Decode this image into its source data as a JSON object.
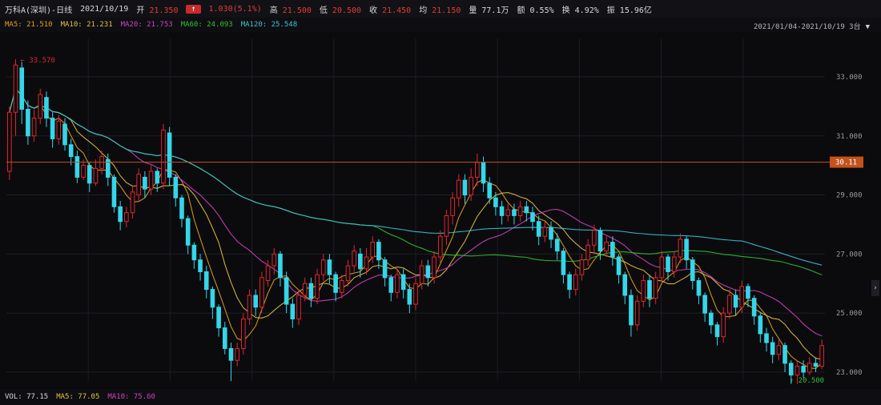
{
  "infobar": {
    "name": "万科A(深圳)-日线",
    "date": "2021/10/19",
    "open_label": "开",
    "open_value": "21.350",
    "pill": "↑",
    "change": "1.030(5.1%)",
    "high_label": "高",
    "high_value": "21.500",
    "low_label": "低",
    "low_value": "20.500",
    "close_label": "收",
    "close_value": "21.450",
    "avg_label": "均",
    "avg_value": "21.150",
    "volume_label": "量",
    "volume_value": "77.1万",
    "amount_label": "额",
    "amount_value": "0.55%",
    "turnover_label": "换",
    "turnover_value": "4.92%",
    "amplitude_label": "振",
    "amplitude_value": "15.96亿"
  },
  "ma_bar": [
    {
      "label": "MA5: 21.510",
      "color": "#e0a020"
    },
    {
      "label": "MA10: 21.231",
      "color": "#e0c040"
    },
    {
      "label": "MA20: 21.753",
      "color": "#d040c0"
    },
    {
      "label": "MA60: 24.093",
      "color": "#30c030"
    },
    {
      "label": "MA120: 25.548",
      "color": "#40c0d0"
    }
  ],
  "range": {
    "text": "2021/01/04-2021/10/19 3台",
    "arrow": "▼"
  },
  "price_tag": "30.11",
  "high_marker": "33.570",
  "low_marker": "20.500",
  "bottom_bar": [
    {
      "label": "VOL: 77.15",
      "color": "#d8d8d8"
    },
    {
      "label": "MA5: 77.05",
      "color": "#e0c040"
    },
    {
      "label": "MA10: 75.60",
      "color": "#d040c0"
    }
  ],
  "chart_data": {
    "type": "candlestick",
    "ylim": [
      22.7,
      34.3
    ],
    "y_ticks": [
      "33.000",
      "31.000",
      "29.000",
      "27.000",
      "25.000",
      "23.000"
    ],
    "reference_level": 30.11,
    "candles": [
      [
        29.8,
        31.8,
        29.5,
        32.0
      ],
      [
        31.8,
        33.4,
        31.0,
        33.6
      ],
      [
        33.3,
        31.9,
        31.4,
        33.5
      ],
      [
        31.9,
        31.0,
        30.7,
        32.2
      ],
      [
        31.0,
        31.6,
        30.8,
        31.9
      ],
      [
        31.6,
        32.4,
        31.4,
        32.6
      ],
      [
        32.3,
        31.6,
        31.3,
        32.5
      ],
      [
        31.6,
        30.9,
        30.6,
        31.8
      ],
      [
        30.9,
        31.5,
        30.7,
        31.7
      ],
      [
        31.4,
        30.7,
        30.5,
        31.6
      ],
      [
        30.7,
        30.3,
        30.0,
        30.9
      ],
      [
        30.3,
        29.6,
        29.4,
        30.5
      ],
      [
        29.6,
        30.0,
        29.5,
        30.2
      ],
      [
        30.0,
        29.4,
        29.1,
        30.1
      ],
      [
        29.4,
        29.9,
        29.3,
        30.2
      ],
      [
        29.9,
        30.3,
        29.7,
        30.5
      ],
      [
        30.2,
        29.6,
        29.3,
        30.4
      ],
      [
        29.6,
        28.6,
        28.4,
        29.7
      ],
      [
        28.6,
        28.1,
        27.8,
        28.8
      ],
      [
        28.1,
        28.4,
        27.9,
        28.6
      ],
      [
        28.4,
        29.1,
        28.2,
        29.3
      ],
      [
        29.0,
        29.7,
        28.8,
        29.9
      ],
      [
        29.6,
        29.2,
        28.9,
        29.8
      ],
      [
        29.2,
        29.8,
        29.0,
        30.0
      ],
      [
        29.8,
        29.4,
        29.1,
        29.9
      ],
      [
        29.4,
        31.2,
        29.2,
        31.4
      ],
      [
        31.1,
        29.6,
        29.3,
        31.3
      ],
      [
        29.6,
        28.9,
        28.6,
        29.7
      ],
      [
        28.9,
        28.2,
        27.9,
        29.0
      ],
      [
        28.2,
        27.3,
        27.0,
        28.3
      ],
      [
        27.3,
        26.8,
        26.5,
        27.4
      ],
      [
        26.8,
        26.4,
        26.1,
        27.0
      ],
      [
        26.4,
        25.8,
        25.5,
        26.6
      ],
      [
        25.8,
        25.2,
        24.8,
        25.9
      ],
      [
        25.2,
        24.5,
        24.2,
        25.3
      ],
      [
        24.5,
        23.8,
        23.6,
        24.7
      ],
      [
        23.8,
        23.4,
        22.7,
        24.0
      ],
      [
        23.4,
        23.8,
        23.2,
        24.0
      ],
      [
        23.8,
        24.8,
        23.6,
        25.0
      ],
      [
        24.8,
        25.6,
        24.6,
        25.8
      ],
      [
        25.6,
        25.2,
        24.9,
        25.8
      ],
      [
        25.2,
        26.2,
        25.0,
        26.4
      ],
      [
        26.1,
        26.6,
        25.9,
        26.8
      ],
      [
        26.6,
        27.0,
        26.3,
        27.2
      ],
      [
        27.0,
        26.2,
        25.9,
        27.1
      ],
      [
        26.2,
        25.3,
        25.0,
        26.4
      ],
      [
        25.3,
        24.8,
        24.5,
        25.5
      ],
      [
        24.8,
        25.6,
        24.6,
        25.8
      ],
      [
        25.6,
        26.0,
        25.4,
        26.2
      ],
      [
        26.0,
        25.5,
        25.2,
        26.2
      ],
      [
        25.5,
        26.3,
        25.3,
        26.5
      ],
      [
        26.3,
        26.8,
        26.1,
        27.0
      ],
      [
        26.8,
        26.3,
        26.0,
        27.0
      ],
      [
        26.3,
        25.7,
        25.4,
        26.4
      ],
      [
        25.7,
        26.1,
        25.5,
        26.3
      ],
      [
        26.1,
        26.6,
        25.9,
        26.8
      ],
      [
        26.6,
        27.1,
        26.4,
        27.3
      ],
      [
        27.0,
        26.5,
        26.2,
        27.2
      ],
      [
        26.5,
        26.9,
        26.3,
        27.2
      ],
      [
        26.9,
        27.4,
        26.7,
        27.6
      ],
      [
        27.4,
        26.8,
        26.5,
        27.5
      ],
      [
        26.8,
        26.2,
        25.9,
        26.9
      ],
      [
        26.2,
        25.7,
        25.4,
        26.3
      ],
      [
        25.7,
        26.3,
        25.5,
        26.5
      ],
      [
        26.3,
        25.8,
        25.5,
        26.5
      ],
      [
        25.8,
        25.3,
        25.0,
        26.0
      ],
      [
        25.3,
        26.0,
        25.1,
        26.2
      ],
      [
        26.0,
        26.6,
        25.8,
        26.8
      ],
      [
        26.6,
        26.2,
        25.9,
        26.8
      ],
      [
        26.2,
        26.9,
        26.0,
        27.1
      ],
      [
        26.9,
        27.6,
        26.7,
        27.8
      ],
      [
        27.6,
        28.3,
        27.3,
        28.5
      ],
      [
        28.3,
        28.9,
        28.0,
        29.1
      ],
      [
        28.9,
        29.5,
        28.6,
        29.7
      ],
      [
        29.5,
        29.0,
        28.7,
        29.7
      ],
      [
        29.0,
        29.6,
        28.8,
        29.9
      ],
      [
        29.6,
        30.1,
        29.3,
        30.4
      ],
      [
        30.1,
        29.4,
        29.1,
        30.3
      ],
      [
        29.4,
        28.9,
        28.7,
        29.6
      ],
      [
        28.9,
        28.6,
        28.3,
        29.1
      ],
      [
        28.6,
        28.3,
        28.0,
        28.8
      ],
      [
        28.3,
        28.5,
        28.1,
        28.7
      ],
      [
        28.5,
        28.3,
        28.0,
        28.7
      ],
      [
        28.3,
        28.6,
        28.1,
        28.8
      ],
      [
        28.6,
        28.4,
        28.1,
        28.8
      ],
      [
        28.4,
        28.1,
        27.8,
        28.6
      ],
      [
        28.1,
        27.6,
        27.3,
        28.3
      ],
      [
        27.6,
        27.9,
        27.4,
        28.1
      ],
      [
        27.9,
        27.5,
        27.2,
        28.1
      ],
      [
        27.5,
        27.1,
        26.8,
        27.7
      ],
      [
        27.1,
        26.3,
        26.0,
        27.2
      ],
      [
        26.3,
        25.8,
        25.5,
        26.4
      ],
      [
        25.8,
        26.3,
        25.6,
        26.5
      ],
      [
        26.3,
        26.8,
        26.1,
        27.0
      ],
      [
        26.8,
        27.3,
        26.6,
        27.5
      ],
      [
        27.3,
        27.8,
        27.0,
        28.0
      ],
      [
        27.8,
        27.1,
        26.8,
        27.9
      ],
      [
        27.1,
        27.4,
        26.9,
        27.6
      ],
      [
        27.4,
        26.9,
        26.6,
        27.6
      ],
      [
        26.9,
        26.3,
        26.0,
        27.0
      ],
      [
        26.3,
        25.6,
        25.3,
        26.4
      ],
      [
        25.6,
        24.6,
        24.2,
        25.8
      ],
      [
        24.6,
        25.4,
        24.4,
        25.6
      ],
      [
        25.4,
        26.1,
        25.2,
        26.3
      ],
      [
        26.1,
        25.5,
        25.2,
        26.3
      ],
      [
        25.5,
        26.2,
        25.3,
        26.4
      ],
      [
        26.2,
        26.9,
        26.0,
        27.1
      ],
      [
        26.9,
        26.4,
        26.1,
        27.0
      ],
      [
        26.4,
        26.9,
        26.2,
        27.1
      ],
      [
        26.9,
        27.5,
        26.7,
        27.7
      ],
      [
        27.5,
        26.8,
        26.5,
        27.6
      ],
      [
        26.8,
        26.1,
        25.8,
        26.9
      ],
      [
        26.1,
        25.6,
        25.3,
        26.2
      ],
      [
        25.6,
        25.0,
        24.7,
        25.7
      ],
      [
        25.0,
        24.6,
        24.3,
        25.1
      ],
      [
        24.6,
        24.2,
        23.9,
        24.7
      ],
      [
        24.2,
        25.0,
        24.0,
        25.2
      ],
      [
        25.0,
        25.6,
        24.8,
        25.8
      ],
      [
        25.6,
        25.2,
        24.9,
        25.8
      ],
      [
        25.2,
        25.9,
        25.0,
        26.1
      ],
      [
        25.9,
        25.5,
        25.2,
        26.0
      ],
      [
        25.5,
        24.9,
        24.6,
        25.6
      ],
      [
        24.9,
        24.3,
        24.0,
        25.0
      ],
      [
        24.3,
        24.0,
        23.7,
        24.5
      ],
      [
        24.0,
        23.6,
        23.3,
        24.2
      ],
      [
        23.6,
        23.9,
        23.4,
        24.1
      ],
      [
        23.9,
        23.3,
        23.0,
        24.0
      ],
      [
        23.3,
        22.9,
        22.6,
        23.4
      ],
      [
        22.9,
        23.2,
        22.6,
        23.4
      ],
      [
        23.2,
        23.0,
        22.8,
        23.4
      ],
      [
        23.0,
        23.3,
        22.9,
        23.5
      ],
      [
        23.3,
        23.2,
        23.0,
        23.5
      ],
      [
        23.2,
        23.9,
        23.1,
        24.1
      ]
    ]
  }
}
